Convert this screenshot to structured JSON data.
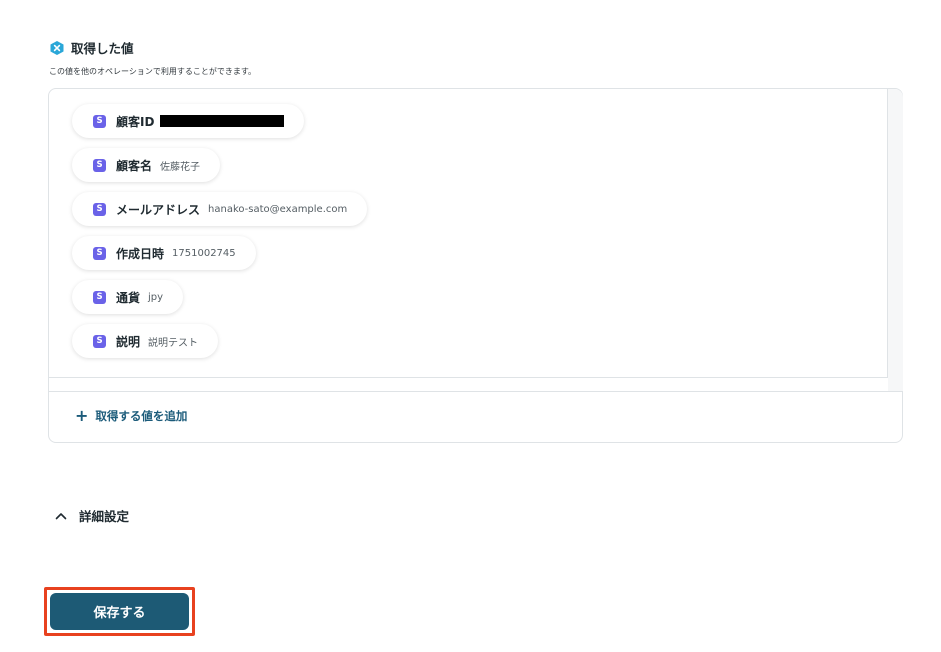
{
  "section": {
    "title": "取得した値",
    "description": "この値を他のオペレーションで利用することができます。",
    "icon": "x-badge-icon"
  },
  "chip_badge": "S",
  "values": [
    {
      "label": "顧客ID",
      "value": "",
      "redacted": true
    },
    {
      "label": "顧客名",
      "value": "佐藤花子"
    },
    {
      "label": "メールアドレス",
      "value": "hanako-sato@example.com"
    },
    {
      "label": "作成日時",
      "value": "1751002745"
    },
    {
      "label": "通貨",
      "value": "jpy"
    },
    {
      "label": "説明",
      "value": "説明テスト"
    }
  ],
  "add_value": {
    "label": "取得する値を追加",
    "icon": "plus-icon"
  },
  "advanced": {
    "label": "詳細設定",
    "icon": "chevron-up-icon"
  },
  "save_button": {
    "label": "保存する"
  },
  "colors": {
    "accent": "#1d5a75",
    "link": "#1b5b7a",
    "badge": "#6a62e8",
    "highlight": "#e8411f",
    "section_icon": "#2aa7d8"
  }
}
